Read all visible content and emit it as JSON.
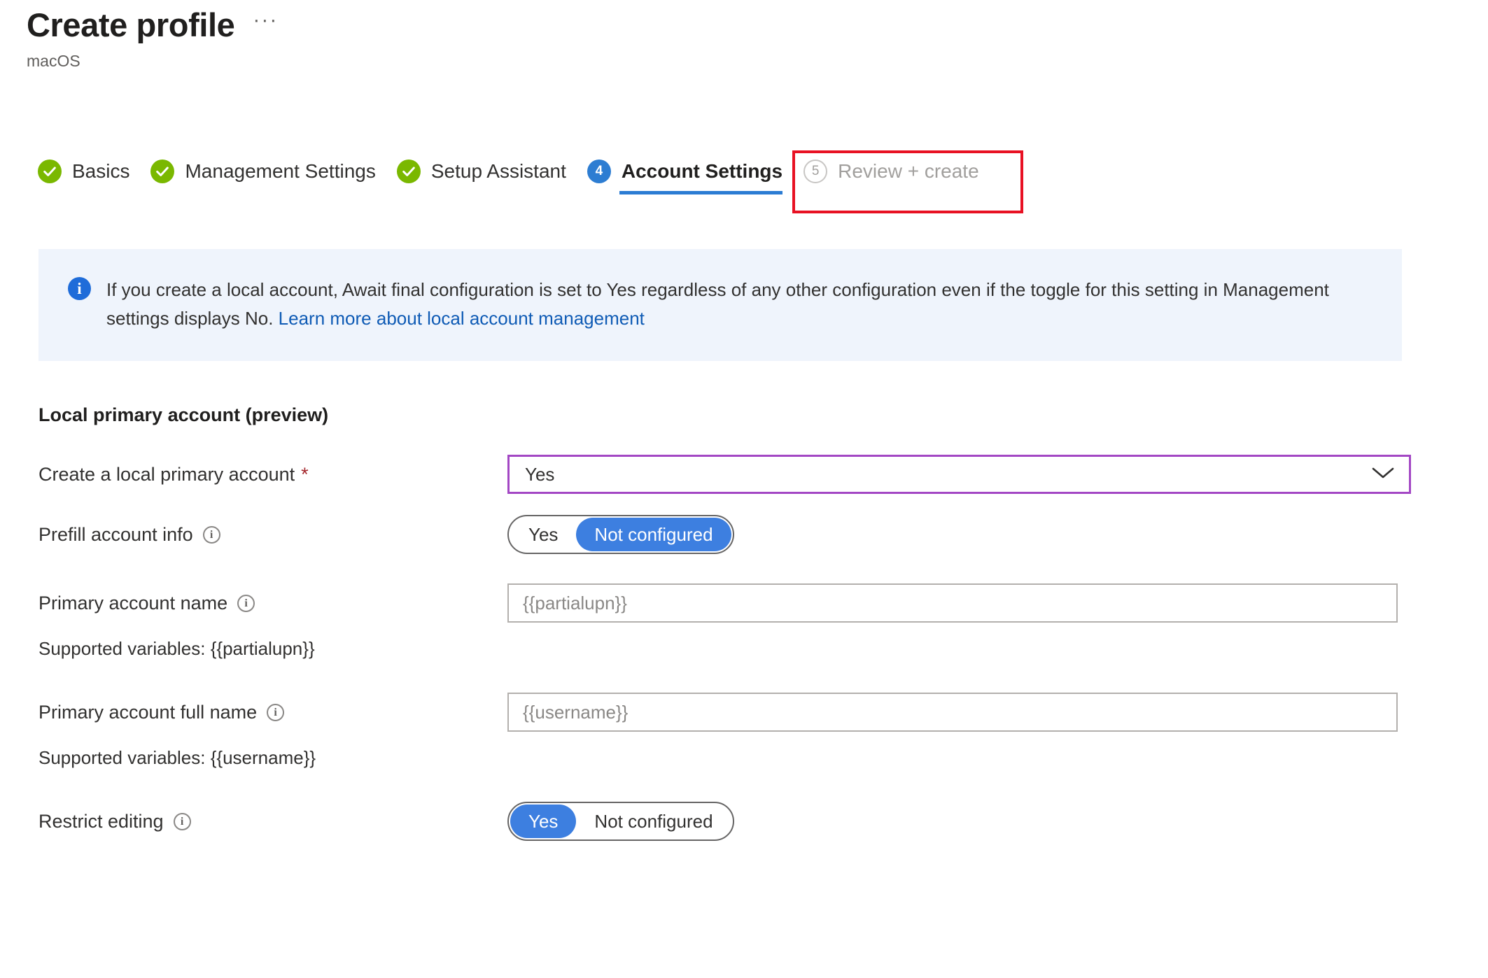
{
  "header": {
    "title": "Create profile",
    "subtitle": "macOS",
    "more_menu": "···"
  },
  "wizard": {
    "tabs": [
      {
        "label": "Basics",
        "state": "done",
        "marker": "check"
      },
      {
        "label": "Management Settings",
        "state": "done",
        "marker": "check"
      },
      {
        "label": "Setup Assistant",
        "state": "done",
        "marker": "check"
      },
      {
        "label": "Account Settings",
        "state": "active",
        "marker": "4"
      },
      {
        "label": "Review + create",
        "state": "pending",
        "marker": "5"
      }
    ],
    "highlight_color": "#e81123",
    "active_color": "#2b7cd3",
    "done_color": "#7ab800"
  },
  "banner": {
    "icon": "info-icon",
    "text_before_link": "If you create a local account, Await final configuration is set to Yes regardless of any other configuration even if the toggle for this setting in Management settings displays No. ",
    "link_text": "Learn more about local account management",
    "background": "#eff4fc",
    "link_color": "#0f5bb5"
  },
  "form": {
    "section_heading": "Local primary account (preview)",
    "create_local_account": {
      "label": "Create a local primary account",
      "required_marker": "*",
      "value": "Yes",
      "chevron": "chevron-down-icon",
      "border_color": "#a347c4"
    },
    "prefill_account_info": {
      "label": "Prefill account info",
      "info": "ℹ",
      "options": [
        "Yes",
        "Not configured"
      ],
      "selected": "Not configured"
    },
    "primary_account_name": {
      "label": "Primary account name",
      "info": "ℹ",
      "value": "{{partialupn}}",
      "placeholder": "{{partialupn}}",
      "helper": "Supported variables: {{partialupn}}"
    },
    "primary_account_full_name": {
      "label": "Primary account full name",
      "info": "ℹ",
      "value": "{{username}}",
      "placeholder": "{{username}}",
      "helper": "Supported variables: {{username}}"
    },
    "restrict_editing": {
      "label": "Restrict editing",
      "info": "ℹ",
      "options": [
        "Yes",
        "Not configured"
      ],
      "selected": "Yes"
    }
  }
}
